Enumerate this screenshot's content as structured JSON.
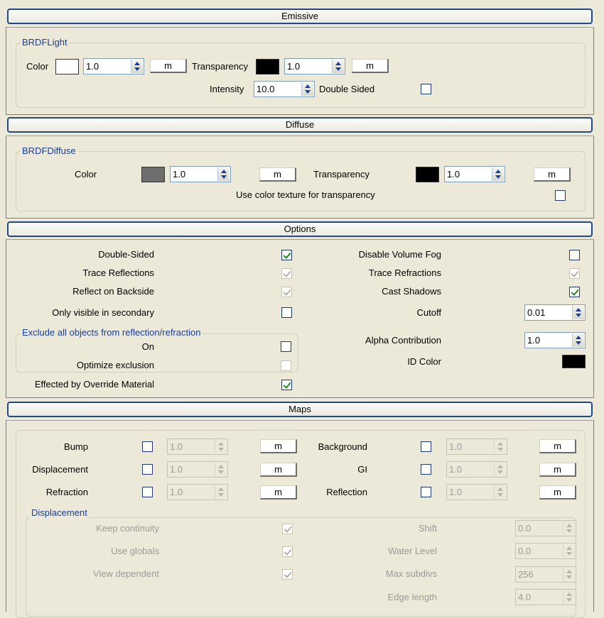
{
  "sections": {
    "emissive": "Emissive",
    "diffuse": "Diffuse",
    "options": "Options",
    "maps": "Maps"
  },
  "emissive": {
    "group_title": "BRDFLight",
    "color_label": "Color",
    "color_value": "1.0",
    "color_map_btn": "m",
    "transparency_label": "Transparency",
    "transparency_value": "1.0",
    "transparency_map_btn": "m",
    "intensity_label": "Intensity",
    "intensity_value": "10.0",
    "double_sided_label": "Double Sided",
    "double_sided_checked": false,
    "colors": {
      "color_swatch": "#ffffff",
      "transparency_swatch": "#000000"
    }
  },
  "diffuse": {
    "group_title": "BRDFDiffuse",
    "color_label": "Color",
    "color_value": "1.0",
    "color_map_btn": "m",
    "transparency_label": "Transparency",
    "transparency_value": "1.0",
    "transparency_map_btn": "m",
    "use_color_texture_label": "Use color texture for transparency",
    "use_color_texture_checked": false,
    "colors": {
      "color_swatch": "#6e6e6e",
      "transparency_swatch": "#000000"
    }
  },
  "options": {
    "double_sided_label": "Double-Sided",
    "trace_reflections_label": "Trace Reflections",
    "reflect_on_backside_label": "Reflect on Backside",
    "only_visible_secondary_label": "Only visible in secondary",
    "exclude_group_title": "Exclude all objects from reflection/refraction",
    "on_label": "On",
    "optimize_exclusion_label": "Optimize exclusion",
    "effected_override_label": "Effected by Override Material",
    "disable_volume_fog_label": "Disable Volume Fog",
    "trace_refractions_label": "Trace Refractions",
    "cast_shadows_label": "Cast Shadows",
    "cutoff_label": "Cutoff",
    "cutoff_value": "0.01",
    "alpha_contribution_label": "Alpha Contribution",
    "alpha_contribution_value": "1.0",
    "id_color_label": "ID Color",
    "colors": {
      "id_color_swatch": "#000000"
    }
  },
  "maps": {
    "bump_label": "Bump",
    "bump_value": "1.0",
    "displacement_label": "Displacement",
    "displacement_value": "1.0",
    "refraction_label": "Refraction",
    "refraction_value": "1.0",
    "background_label": "Background",
    "background_value": "1.0",
    "gi_label": "GI",
    "gi_value": "1.0",
    "reflection_label": "Reflection",
    "reflection_value": "1.0",
    "map_btn": "m",
    "displacement_group_title": "Displacement",
    "keep_continuity_label": "Keep continuity",
    "use_globals_label": "Use globals",
    "view_dependent_label": "View dependent",
    "shift_label": "Shift",
    "shift_value": "0.0",
    "water_level_label": "Water Level",
    "water_level_value": "0.0",
    "max_subdivs_label": "Max subdivs",
    "max_subdivs_value": "256",
    "edge_length_label": "Edge length",
    "edge_length_value": "4.0"
  },
  "theme": {
    "accent": "#1f4a86",
    "group_title_color": "#1a3e9c",
    "check_color": "#1a8a1a",
    "panel_bg": "#ece9d8"
  }
}
